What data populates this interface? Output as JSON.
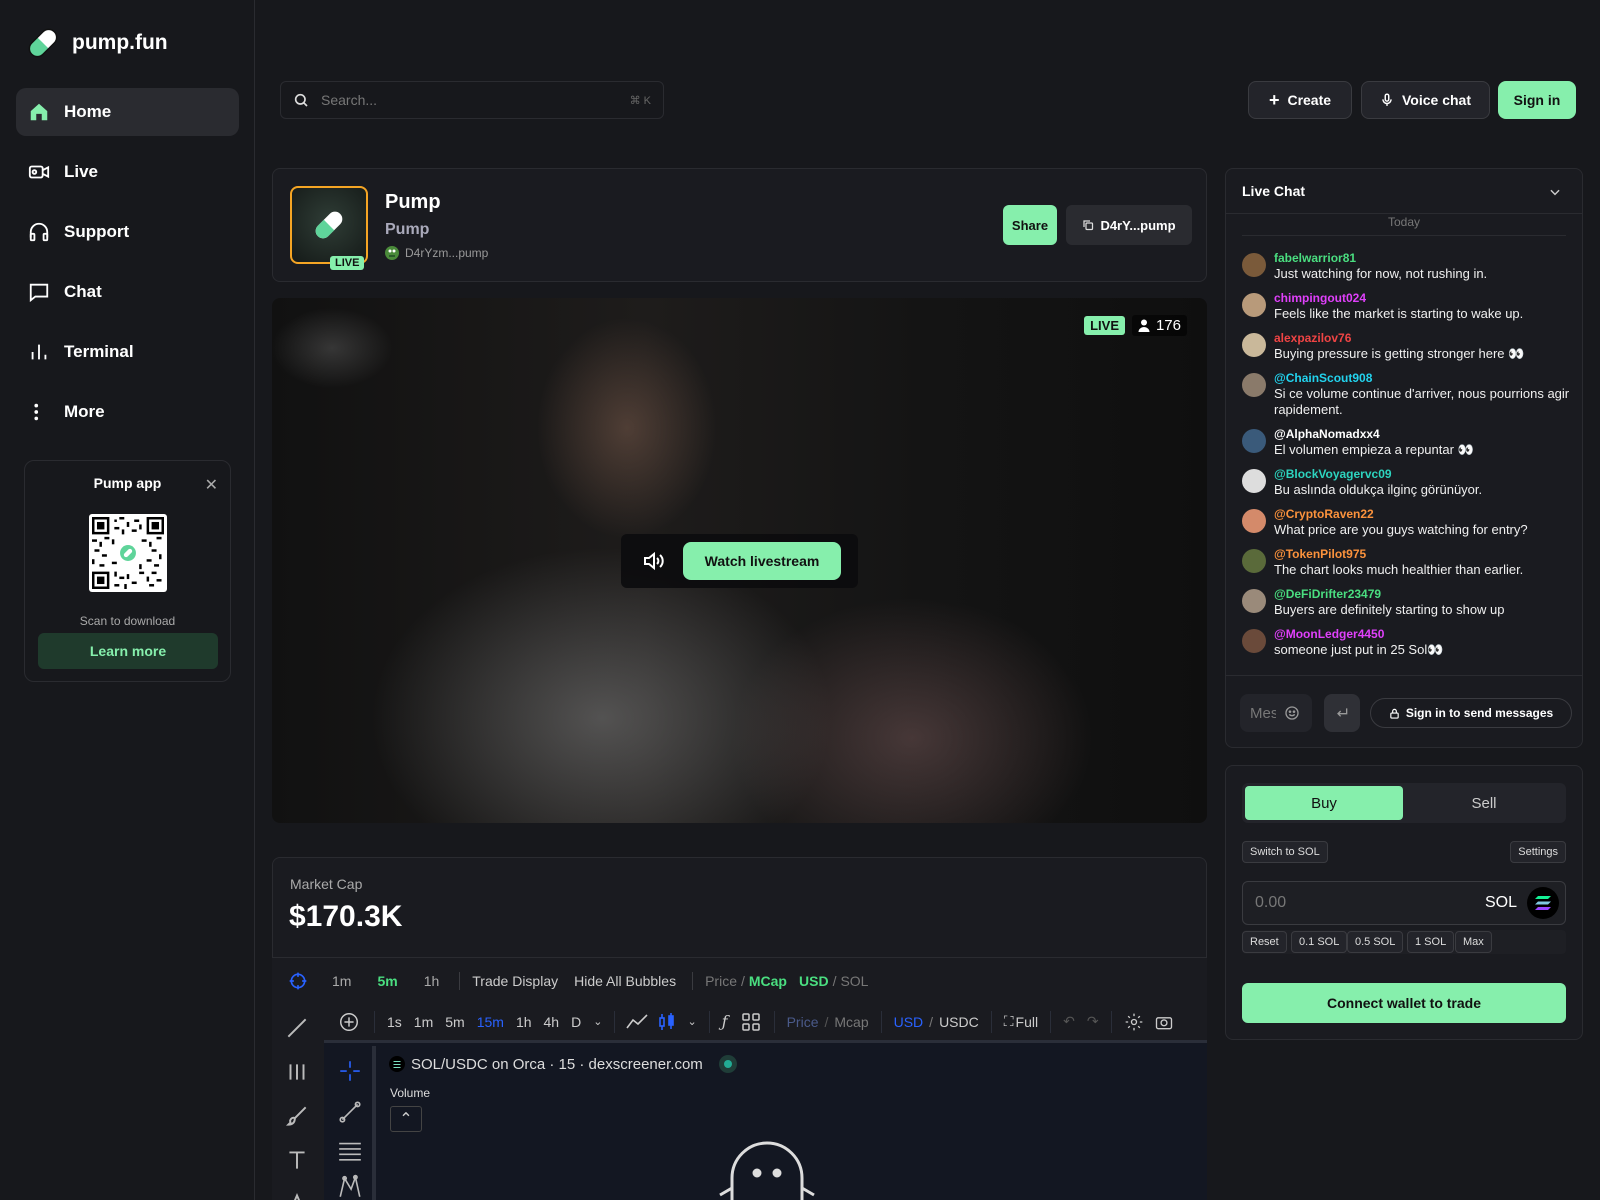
{
  "brand": {
    "name": "pump.fun"
  },
  "nav": [
    {
      "label": "Home",
      "icon": "home-icon",
      "active": true
    },
    {
      "label": "Live",
      "icon": "video-icon"
    },
    {
      "label": "Support",
      "icon": "headphones-icon"
    },
    {
      "label": "Chat",
      "icon": "chat-icon"
    },
    {
      "label": "Terminal",
      "icon": "chart-bars-icon"
    },
    {
      "label": "More",
      "icon": "dots-icon"
    }
  ],
  "app_card": {
    "title": "Pump app",
    "scan_text": "Scan to download",
    "button": "Learn more"
  },
  "search": {
    "placeholder": "Search...",
    "shortcut": "⌘ K"
  },
  "topbar": {
    "create": "Create",
    "voice_chat": "Voice chat",
    "sign_in": "Sign in"
  },
  "token": {
    "name": "Pump",
    "symbol": "Pump",
    "creator": "D4rYzm...pump",
    "live_badge": "LIVE",
    "share": "Share",
    "contract": "D4rY...pump"
  },
  "video": {
    "live_badge": "LIVE",
    "viewers": "176",
    "watch_button": "Watch livestream"
  },
  "market": {
    "label": "Market Cap",
    "value": "$170.3K"
  },
  "timeframes": {
    "options": [
      "1m",
      "5m",
      "1h"
    ],
    "selected": "5m",
    "trade_display": "Trade Display",
    "hide_bubbles": "Hide All Bubbles",
    "price": "Price",
    "mcap": "MCap",
    "usd": "USD",
    "sol": "SOL",
    "slash": "/"
  },
  "chart_toolbar": {
    "intervals": [
      "1s",
      "1m",
      "5m",
      "15m",
      "1h",
      "4h",
      "D"
    ],
    "selected": "15m",
    "price": "Price",
    "mcap": "Mcap",
    "usd": "USD",
    "usdc": "USDC",
    "full": "Full",
    "slash": "/"
  },
  "chart": {
    "pair": "SOL/USDC on Orca · 15 · dexscreener.com",
    "volume": "Volume"
  },
  "chat": {
    "title": "Live Chat",
    "day": "Today",
    "messages": [
      {
        "user": "fabelwarrior81",
        "color": "#4ade80",
        "text": "Just watching for now, not rushing in.",
        "avatar": "#7a5a3a"
      },
      {
        "user": "chimpingout024",
        "color": "#e040fb",
        "text": "Feels like the market is starting to wake up.",
        "avatar": "#b89a7a"
      },
      {
        "user": "alexpazilov76",
        "color": "#ef4444",
        "text": "Buying pressure is getting stronger here 👀",
        "avatar": "#c9b89a"
      },
      {
        "user": "@ChainScout908",
        "color": "#22d3ee",
        "text": "Si ce volume continue d'arriver, nous pourrions agir rapidement.",
        "avatar": "#8a7a6a"
      },
      {
        "user": "@AlphaNomadxx4",
        "color": "#ffffff",
        "text": "El volumen empieza a repuntar 👀",
        "avatar": "#3a5a7a"
      },
      {
        "user": "@BlockVoyagervc09",
        "color": "#2dd4bf",
        "text": "Bu aslında oldukça ilginç görünüyor.",
        "avatar": "#ddd"
      },
      {
        "user": "@CryptoRaven22",
        "color": "#fb923c",
        "text": "What price are you guys watching for entry?",
        "avatar": "#d48a6a"
      },
      {
        "user": "@TokenPilot975",
        "color": "#fb923c",
        "text": "The chart looks much healthier than earlier.",
        "avatar": "#5a6a3a"
      },
      {
        "user": "@DeFiDrifter23479",
        "color": "#4ade80",
        "text": "Buyers are definitely starting to show up",
        "avatar": "#9a8a7a"
      },
      {
        "user": "@MoonLedger4450",
        "color": "#e040fb",
        "text": "someone just put in 25 Sol👀",
        "avatar": "#6a4a3a"
      }
    ],
    "input_placeholder": "Message",
    "signin_prompt": "Sign in to send messages"
  },
  "trade": {
    "buy": "Buy",
    "sell": "Sell",
    "switch": "Switch to SOL",
    "settings": "Settings",
    "amount_placeholder": "0.00",
    "currency": "SOL",
    "quick": [
      "Reset",
      "0.1 SOL",
      "0.5 SOL",
      "1 SOL",
      "Max"
    ],
    "connect": "Connect wallet to trade"
  },
  "colors": {
    "accent": "#86efac",
    "background": "#17181c",
    "panel": "#1a1b20"
  }
}
